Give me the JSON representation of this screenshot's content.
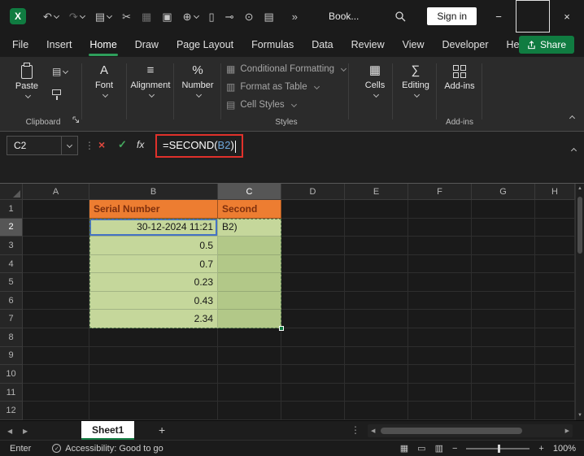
{
  "colors": {
    "excel_green": "#107C41",
    "tab_underline": "#2E9E5B",
    "header_fill": "#ED7D31",
    "header_text": "#7E2F0D",
    "input_fill": "#C5D79B",
    "result_fill": "#B2C888",
    "ref_border": "#4472C4",
    "annotation_red": "#E0312B",
    "formula_ref_blue": "#6FA8DC"
  },
  "icons": {
    "undo": "↶",
    "redo": "↷",
    "overflow": "»",
    "minimize": "−",
    "close": "×",
    "cancel": "×",
    "enter": "✓",
    "fx": "fx",
    "dots": "⋮",
    "font": "A",
    "alignment": "≡",
    "number": "%",
    "cells": "▦",
    "editing": "∑",
    "copy": "▤",
    "cond_format": "▦",
    "format_table": "▥",
    "cell_styles": "▤",
    "normal_view": "▦",
    "page_layout": "▭",
    "page_break": "▥",
    "zoom_out": "−",
    "zoom_in": "+",
    "prev": "◀",
    "next": "▶",
    "up": "▲",
    "down": "▼",
    "check": "✓",
    "add": "+"
  },
  "titlebar": {
    "document_name": "Book...",
    "sign_in_label": "Sign in",
    "qat": [
      {
        "name": "touch-mode-icon",
        "glyph": "▤",
        "chevron": true,
        "dim": false
      },
      {
        "name": "cut-icon",
        "glyph": "✂",
        "chevron": false,
        "dim": false
      },
      {
        "name": "picture-icon",
        "glyph": "▦",
        "chevron": false,
        "dim": true
      },
      {
        "name": "copy-icon",
        "glyph": "▣",
        "chevron": false,
        "dim": false
      },
      {
        "name": "web-icon",
        "glyph": "⊕",
        "chevron": true,
        "dim": false
      },
      {
        "name": "new-document-icon",
        "glyph": "▯",
        "chevron": false,
        "dim": false
      },
      {
        "name": "attach-icon",
        "glyph": "⊸",
        "chevron": false,
        "dim": false
      },
      {
        "name": "camera-icon",
        "glyph": "⊙",
        "chevron": false,
        "dim": false
      },
      {
        "name": "table-icon",
        "glyph": "▤",
        "chevron": false,
        "dim": false
      }
    ]
  },
  "menu": {
    "tabs": [
      {
        "label": "File",
        "active": false
      },
      {
        "label": "Insert",
        "active": false
      },
      {
        "label": "Home",
        "active": true
      },
      {
        "label": "Draw",
        "active": false
      },
      {
        "label": "Page Layout",
        "active": false
      },
      {
        "label": "Formulas",
        "active": false
      },
      {
        "label": "Data",
        "active": false
      },
      {
        "label": "Review",
        "active": false
      },
      {
        "label": "View",
        "active": false
      },
      {
        "label": "Developer",
        "active": false
      },
      {
        "label": "Help",
        "active": false
      }
    ],
    "share_label": "Share"
  },
  "ribbon": {
    "paste_label": "Paste",
    "font_label": "Font",
    "alignment_label": "Alignment",
    "number_label": "Number",
    "styles_items": [
      {
        "label": "Conditional Formatting"
      },
      {
        "label": "Format as Table"
      },
      {
        "label": "Cell Styles"
      }
    ],
    "cells_label": "Cells",
    "editing_label": "Editing",
    "addins_label": "Add-ins",
    "group_clipboard": "Clipboard",
    "group_styles": "Styles",
    "group_addins": "Add-ins"
  },
  "formula_bar": {
    "name_box": "C2",
    "formula_prefix": "=SECOND(",
    "formula_ref": "B2",
    "formula_suffix": ")"
  },
  "grid": {
    "columns": [
      "A",
      "B",
      "C",
      "D",
      "E",
      "F",
      "G",
      "H"
    ],
    "row_count": 12,
    "active_column": "C",
    "active_row": "2",
    "cells": [
      {
        "ref": "B1",
        "value": "Serial Number",
        "style": "header",
        "align": "left",
        "bold": true
      },
      {
        "ref": "C1",
        "value": "Second",
        "style": "header",
        "align": "left",
        "bold": true
      },
      {
        "ref": "B2",
        "value": "30-12-2024 11:21",
        "style": "input",
        "align": "right",
        "ref_border": true
      },
      {
        "ref": "C2",
        "value": "B2)",
        "style": "input",
        "align": "left"
      },
      {
        "ref": "B3",
        "value": "0.5",
        "style": "input",
        "align": "right"
      },
      {
        "ref": "B4",
        "value": "0.7",
        "style": "input",
        "align": "right"
      },
      {
        "ref": "B5",
        "value": "0.23",
        "style": "input",
        "align": "right"
      },
      {
        "ref": "B6",
        "value": "0.43",
        "style": "input",
        "align": "right"
      },
      {
        "ref": "B7",
        "value": "2.34",
        "style": "input",
        "align": "right"
      },
      {
        "ref": "C3",
        "value": "",
        "style": "result"
      },
      {
        "ref": "C4",
        "value": "",
        "style": "result"
      },
      {
        "ref": "C5",
        "value": "",
        "style": "result"
      },
      {
        "ref": "C6",
        "value": "",
        "style": "result"
      },
      {
        "ref": "C7",
        "value": "",
        "style": "result"
      }
    ]
  },
  "sheet_bar": {
    "tabs": [
      {
        "label": "Sheet1",
        "active": true
      }
    ]
  },
  "status_bar": {
    "mode": "Enter",
    "accessibility_label": "Accessibility: Good to go",
    "zoom_level": "100%"
  }
}
